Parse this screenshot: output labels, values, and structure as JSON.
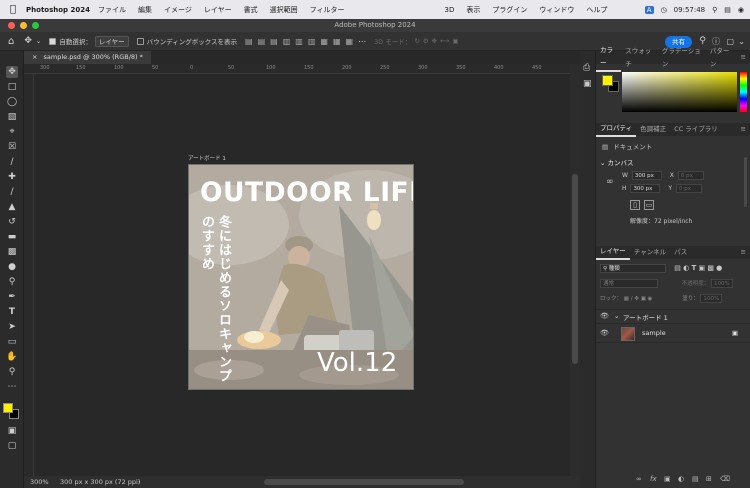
{
  "menubar": {
    "app_name": "Photoshop 2024",
    "items": [
      "ファイル",
      "編集",
      "イメージ",
      "レイヤー",
      "書式",
      "選択範囲",
      "フィルター",
      "3D",
      "表示",
      "プラグイン",
      "ウィンドウ",
      "ヘルプ"
    ],
    "input_indicator": "A",
    "clock": "09:57:48"
  },
  "window": {
    "title": "Adobe Photoshop 2024"
  },
  "options_bar": {
    "auto_select_label": "自動選択：",
    "auto_select_value": "レイヤー",
    "bounding_box_label": "バウンディングボックスを表示",
    "mode_3d_label": "3D モード：",
    "share_label": "共有"
  },
  "document_tab": {
    "label": "sample.psd @ 300% (RGB/8) *"
  },
  "ruler_ticks": [
    "300",
    "150",
    "100",
    "50",
    "0",
    "50",
    "100",
    "150",
    "200",
    "250",
    "300",
    "350",
    "400",
    "450",
    "500",
    "550"
  ],
  "artboard": {
    "label": "アートボード 1",
    "title": "OUTDOOR LIFE",
    "vertical_text": "冬にはじめるソロキャンプのすすめ",
    "volume": "Vol.12"
  },
  "status_bar": {
    "zoom": "300%",
    "doc_info": "300 px x 300 px (72 ppi)"
  },
  "color_panel": {
    "tabs": [
      "カラー",
      "スウォッチ",
      "グラデーション",
      "パターン"
    ],
    "foreground": "#fff200",
    "background": "#000000"
  },
  "properties_panel": {
    "tabs": [
      "プロパティ",
      "色調補正",
      "CC ライブラリ"
    ],
    "doc_label": "ドキュメント",
    "canvas_label": "カンバス",
    "width_label": "W",
    "width_value": "300 px",
    "height_label": "H",
    "height_value": "300 px",
    "x_label": "X",
    "x_placeholder": "0 px",
    "y_label": "Y",
    "y_placeholder": "0 px",
    "resolution": "解像度：72 pixel/inch"
  },
  "layers_panel": {
    "tabs": [
      "レイヤー",
      "チャンネル",
      "パス"
    ],
    "filter_label": "種類",
    "blend_mode": "通常",
    "opacity_label": "不透明度：",
    "opacity_value": "100%",
    "lock_label": "ロック：",
    "fill_label": "塗り：",
    "fill_value": "100%",
    "layers": [
      {
        "name": "アートボード 1"
      },
      {
        "name": "sample"
      }
    ]
  }
}
